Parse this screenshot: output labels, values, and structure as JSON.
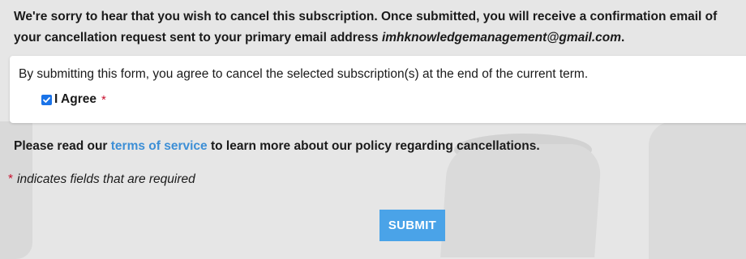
{
  "intro": {
    "text": "We're sorry to hear that you wish to cancel this subscription. Once submitted, you will receive a confirmation email of your cancellation request sent to your primary email address",
    "email": "imhknowledgemanagement@gmail.com",
    "period": "."
  },
  "form": {
    "consent_text": "By submitting this form, you agree to cancel the selected subscription(s) at the end of the current term.",
    "agree_label": "I Agree",
    "agree_checked": true,
    "required_marker": "*"
  },
  "policy": {
    "prefix": "Please read our",
    "link_text": "terms of service",
    "suffix": "to learn more about our policy regarding cancellations."
  },
  "required_note": {
    "marker": "*",
    "text": "indicates fields that are required"
  },
  "submit": {
    "label": "SUBMIT"
  },
  "colors": {
    "link": "#3d8fd6",
    "required": "#c8102e",
    "button": "#4aa3e8",
    "checkbox": "#1a73e8",
    "background": "#e6e6e6"
  }
}
